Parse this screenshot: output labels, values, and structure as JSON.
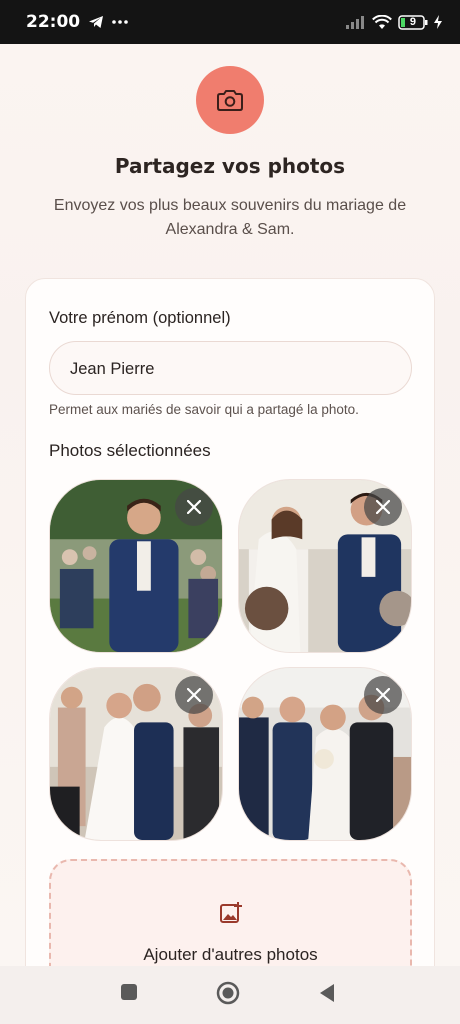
{
  "status_bar": {
    "time": "22:00",
    "battery": "9"
  },
  "header": {
    "icon": "camera-icon",
    "title": "Partagez vos photos",
    "subtitle": "Envoyez vos plus beaux souvenirs du mariage de Alexandra & Sam."
  },
  "form": {
    "name_label": "Votre prénom (optionnel)",
    "name_value": "Jean Pierre",
    "name_help": "Permet aux mariés de savoir qui a partagé la photo.",
    "photos_label": "Photos sélectionnées",
    "photos": [
      {
        "alt": "groom-in-garden"
      },
      {
        "alt": "couple-at-altar"
      },
      {
        "alt": "couple-kissing"
      },
      {
        "alt": "bride-walking-aisle"
      }
    ],
    "add_more_label": "Ajouter d'autres photos"
  },
  "colors": {
    "accent": "#f07d6e",
    "background": "#faf5f2",
    "dashed_border": "#e9b8ae"
  }
}
